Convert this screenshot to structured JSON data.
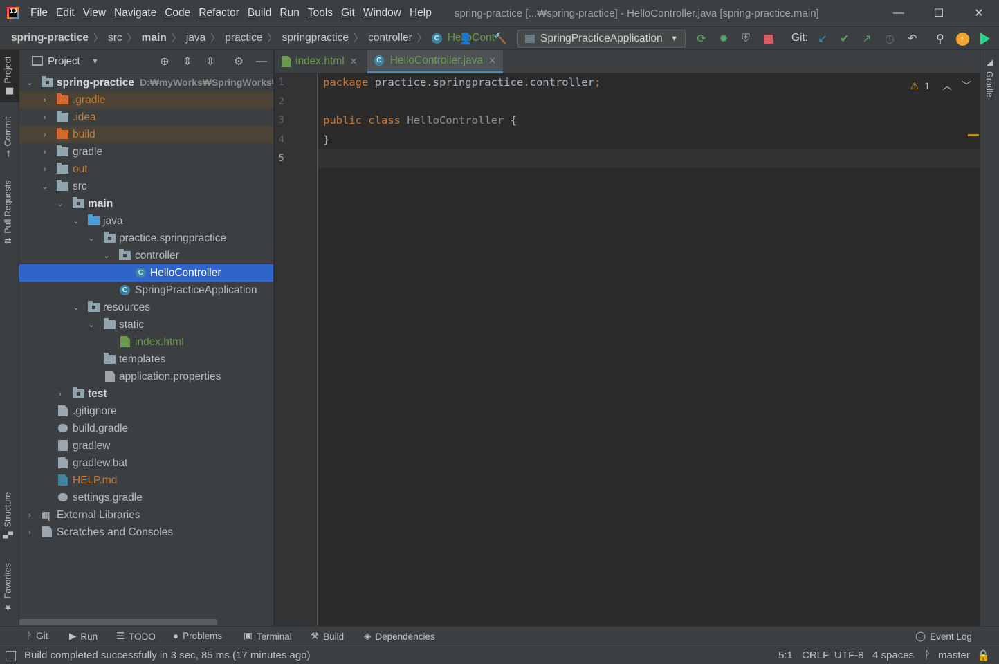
{
  "title_bar": {
    "logo_text": "IJ",
    "menu": [
      {
        "label": "File",
        "u": "F",
        "rest": "ile"
      },
      {
        "label": "Edit",
        "u": "E",
        "rest": "dit"
      },
      {
        "label": "View",
        "u": "V",
        "rest": "iew"
      },
      {
        "label": "Navigate",
        "u": "N",
        "rest": "avigate"
      },
      {
        "label": "Code",
        "u": "C",
        "rest": "ode"
      },
      {
        "label": "Refactor",
        "u": "R",
        "rest": "efactor"
      },
      {
        "label": "Build",
        "u": "B",
        "rest": "uild"
      },
      {
        "label": "Run",
        "u": "R",
        "rest": "un"
      },
      {
        "label": "Tools",
        "u": "T",
        "rest": "ools"
      },
      {
        "label": "Git",
        "u": "G",
        "rest": "it"
      },
      {
        "label": "Window",
        "u": "W",
        "rest": "indow"
      },
      {
        "label": "Help",
        "u": "H",
        "rest": "elp"
      }
    ],
    "window_title": "spring-practice [...₩spring-practice] - HelloController.java [spring-practice.main]",
    "minimize": "—",
    "maximize": "☐",
    "close": "✕"
  },
  "nav": {
    "crumbs": [
      "spring-practice",
      "src",
      "main",
      "java",
      "practice",
      "springpractice",
      "controller"
    ],
    "current_file": "HelloCont",
    "run_config": "SpringPracticeApplication",
    "git_label": "Git:",
    "class_icon": "C"
  },
  "left_strip": {
    "project": "Project",
    "commit": "Commit",
    "pull_requests": "Pull Requests",
    "structure": "Structure",
    "favorites": "Favorites"
  },
  "right_strip": {
    "gradle": "Gradle"
  },
  "project_panel": {
    "title": "Project",
    "root_name": "spring-practice",
    "root_path": "D:₩myWorks₩SpringWorks₩s",
    "tree": {
      "gradle_hidden": ".gradle",
      "idea": ".idea",
      "build": "build",
      "gradle": "gradle",
      "out": "out",
      "src": "src",
      "main": "main",
      "java": "java",
      "pkg": "practice.springpractice",
      "controller": "controller",
      "hello": "HelloController",
      "app": "SpringPracticeApplication",
      "resources": "resources",
      "static": "static",
      "index": "index.html",
      "templates": "templates",
      "props": "application.properties",
      "test": "test",
      "gitignore": ".gitignore",
      "build_gradle": "build.gradle",
      "gradlew": "gradlew",
      "gradlew_bat": "gradlew.bat",
      "help": "HELP.md",
      "settings": "settings.gradle",
      "ext_libs": "External Libraries",
      "scratches": "Scratches and Consoles"
    }
  },
  "editor": {
    "tabs": [
      {
        "label": "index.html",
        "active": false
      },
      {
        "label": "HelloController.java",
        "active": true
      }
    ],
    "line_numbers": [
      "1",
      "2",
      "3",
      "4",
      "5"
    ],
    "code": {
      "l1_kw": "package",
      "l1_rest": " practice.springpractice.controller",
      "l1_semi": ";",
      "l3_kw1": "public",
      "l3_kw2": "class",
      "l3_name": "HelloController",
      "l3_brace": "{",
      "l4": "}"
    },
    "warning_count": "1"
  },
  "bottom_tools": [
    "Git",
    "Run",
    "TODO",
    "Problems",
    "Terminal",
    "Build",
    "Dependencies"
  ],
  "event_log": "Event Log",
  "status": {
    "message": "Build completed successfully in 3 sec, 85 ms (17 minutes ago)",
    "position": "5:1",
    "line_sep": "CRLF",
    "encoding": "UTF-8",
    "indent": "4 spaces",
    "branch": "master"
  },
  "colors": {
    "keyword": "#cc7832",
    "selection": "#2f65ca",
    "excluded_bg": "#4a4336",
    "orange_text": "#c77c37",
    "green_text": "#6a9a4f"
  }
}
